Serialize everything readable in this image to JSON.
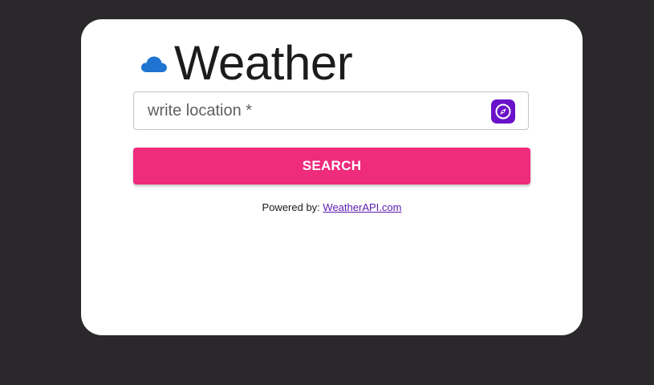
{
  "app": {
    "title": "Weather",
    "icon": "cloud-icon",
    "icon_color": "#1e74d0"
  },
  "search": {
    "placeholder": "write location *",
    "value": "",
    "location_button_icon": "compass-icon",
    "location_button_color": "#6a12c9",
    "button_label": "SEARCH",
    "button_color": "#ef2b7c"
  },
  "footer": {
    "powered_label": "Powered by:",
    "link_text": "WeatherAPI.com"
  },
  "colors": {
    "background": "#2a282b",
    "card": "#ffffff",
    "link": "#5a1ab0"
  }
}
